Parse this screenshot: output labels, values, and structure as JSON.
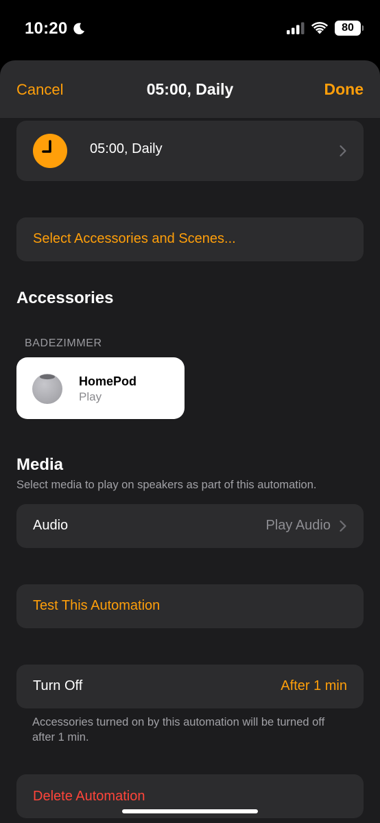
{
  "status_bar": {
    "time": "10:20",
    "battery": "80",
    "icons": [
      "moon-icon",
      "cellular-signal-icon",
      "wifi-icon",
      "battery-icon"
    ]
  },
  "nav": {
    "cancel_label": "Cancel",
    "title": "05:00, Daily",
    "done_label": "Done"
  },
  "trigger": {
    "label": "05:00, Daily",
    "icon": "clock-icon"
  },
  "select_link": "Select Accessories and Scenes...",
  "accessories": {
    "heading": "Accessories",
    "room": "BADEZIMMER",
    "items": [
      {
        "name": "HomePod",
        "status": "Play",
        "icon": "homepod-mini-icon"
      }
    ]
  },
  "media": {
    "heading": "Media",
    "subtitle": "Select media to play on speakers as part of this automation.",
    "audio_label": "Audio",
    "audio_value": "Play Audio"
  },
  "test_link": "Test This Automation",
  "turn_off": {
    "label": "Turn Off",
    "value": "After 1 min",
    "footnote": "Accessories turned on by this automation will be turned off after 1 min."
  },
  "delete_link": "Delete Automation",
  "colors": {
    "accent": "#ff9f0a",
    "destructive": "#ff453a",
    "background": "#1c1c1e",
    "card": "#2c2c2e"
  }
}
